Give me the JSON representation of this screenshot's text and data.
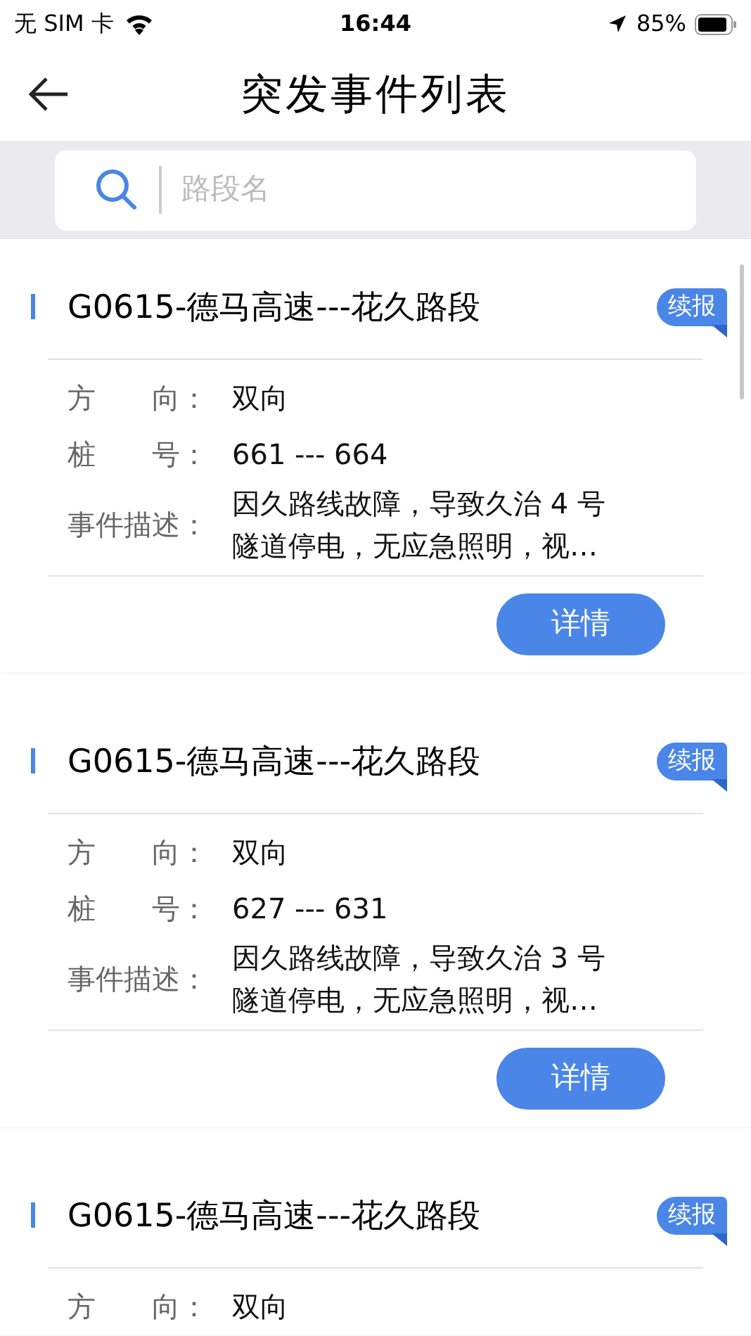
{
  "status_bar": {
    "carrier": "无 SIM 卡",
    "time": "16:44",
    "battery": "85%"
  },
  "nav": {
    "title": "突发事件列表"
  },
  "search": {
    "placeholder": "路段名"
  },
  "events": [
    {
      "title": "G0615-德马高速---花久路段",
      "badge": "续报",
      "fields": [
        {
          "label": "方　　向：",
          "value": "双向"
        },
        {
          "label": "桩　　号：",
          "value": "661 --- 664"
        },
        {
          "label": "事件描述：",
          "value": "因久路线故障，导致久治 4 号隧道停电，无应急照明，视…"
        }
      ],
      "button": "详情"
    },
    {
      "title": "G0615-德马高速---花久路段",
      "badge": "续报",
      "fields": [
        {
          "label": "方　　向：",
          "value": "双向"
        },
        {
          "label": "桩　　号：",
          "value": "627 --- 631"
        },
        {
          "label": "事件描述：",
          "value": "因久路线故障，导致久治 3 号隧道停电，无应急照明，视…"
        }
      ],
      "button": "详情"
    },
    {
      "title": "G0615-德马高速---花久路段",
      "badge": "续报",
      "fields": [
        {
          "label": "方　　向：",
          "value": "双向"
        }
      ]
    }
  ]
}
